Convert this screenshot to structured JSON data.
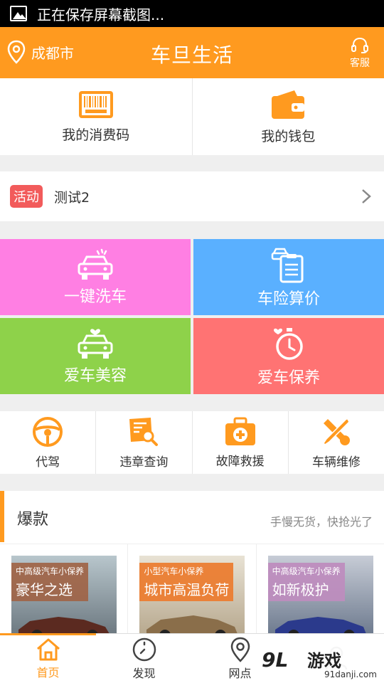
{
  "statusbar": {
    "text": "正在保存屏幕截图..."
  },
  "header": {
    "city": "成都市",
    "title": "车旦生活",
    "service_label": "客服"
  },
  "quick": [
    {
      "label": "我的消费码",
      "icon": "barcode-icon"
    },
    {
      "label": "我的钱包",
      "icon": "wallet-icon"
    }
  ],
  "activity": {
    "tag": "活动",
    "text": "测试2"
  },
  "tiles": [
    {
      "label": "一键洗车",
      "icon": "car-wash-icon",
      "color": "#ff7fe3"
    },
    {
      "label": "车险算价",
      "icon": "insurance-clipboard-icon",
      "color": "#5ab0ff"
    },
    {
      "label": "爱车美容",
      "icon": "car-heart-icon",
      "color": "#8ed24a"
    },
    {
      "label": "爱车保养",
      "icon": "stopwatch-heart-icon",
      "color": "#ff7373"
    }
  ],
  "services": [
    {
      "label": "代驾",
      "icon": "steering-wheel-icon"
    },
    {
      "label": "违章查询",
      "icon": "search-document-icon"
    },
    {
      "label": "故障救援",
      "icon": "first-aid-kit-icon"
    },
    {
      "label": "车辆维修",
      "icon": "wrench-screwdriver-icon"
    }
  ],
  "hot": {
    "title": "爆款",
    "subtitle": "手慢无货，快抢光了",
    "products": [
      {
        "line1": "中高级汽车小保养",
        "line2": "豪华之选"
      },
      {
        "line1": "小型汽车小保养",
        "line2": "城市高温负荷"
      },
      {
        "line1": "中高级汽车小保养",
        "line2": "如新极护"
      }
    ]
  },
  "nav": [
    {
      "label": "首页",
      "icon": "home-icon",
      "active": true
    },
    {
      "label": "发现",
      "icon": "compass-icon",
      "active": false
    },
    {
      "label": "网点",
      "icon": "location-pin-icon",
      "active": false
    },
    {
      "label": "",
      "icon": "user-icon",
      "active": false
    }
  ],
  "watermark": {
    "logo": "9L",
    "brand": "游戏",
    "site": "91danji.com"
  },
  "colors": {
    "accent": "#ff9a1f",
    "activity_tag": "#f25b5b"
  }
}
